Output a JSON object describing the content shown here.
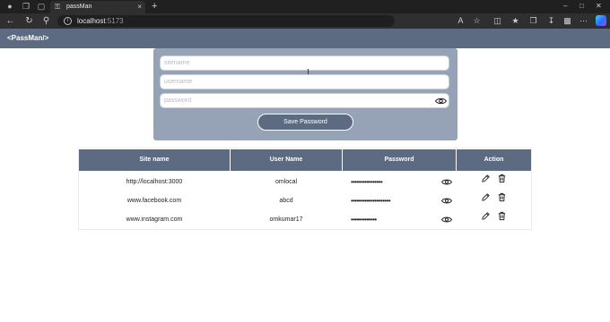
{
  "browser": {
    "tab_title": "passMan",
    "new_tab_glyph": "+",
    "tab_close_glyph": "×",
    "url_host": "localhost",
    "url_port": ":5173",
    "icons": [
      "profile-icon",
      "workspaces-icon",
      "tab-actions-icon",
      "back-icon",
      "refresh-icon",
      "search-icon",
      "site-info-icon",
      "read-aloud-icon",
      "favorite-icon",
      "split-screen-icon",
      "favorites-icon",
      "collections-icon",
      "downloads-icon",
      "extensions-icon",
      "settings-icon",
      "copilot-icon"
    ]
  },
  "app": {
    "logo": "<PassMan/>",
    "accent_color": "#5d6b82",
    "form_bg_color": "#96a2b6"
  },
  "form": {
    "site_placeholder": "sitename",
    "username_placeholder": "username",
    "password_placeholder": "password",
    "save_label": "Save Password"
  },
  "table": {
    "headers": {
      "site": "Site name",
      "user": "User Name",
      "password": "Password",
      "action": "Action"
    },
    "rows": [
      {
        "site": "http://localhost:3000",
        "user": "omlocal",
        "password": "••••••••••••••••"
      },
      {
        "site": "www.facebook.com",
        "user": "abcd",
        "password": "••••••••••••••••••••"
      },
      {
        "site": "www.instagram.com",
        "user": "omkumar17",
        "password": "•••••••••••••"
      }
    ]
  }
}
